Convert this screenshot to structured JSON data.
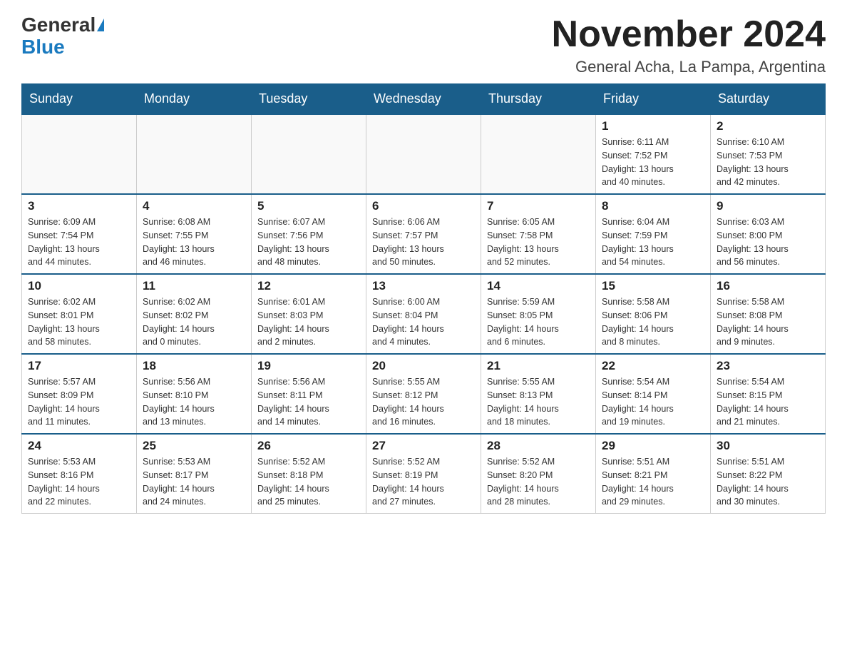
{
  "header": {
    "logo_general": "General",
    "logo_blue": "Blue",
    "month_title": "November 2024",
    "location": "General Acha, La Pampa, Argentina"
  },
  "days_of_week": [
    "Sunday",
    "Monday",
    "Tuesday",
    "Wednesday",
    "Thursday",
    "Friday",
    "Saturday"
  ],
  "weeks": [
    [
      {
        "day": "",
        "info": ""
      },
      {
        "day": "",
        "info": ""
      },
      {
        "day": "",
        "info": ""
      },
      {
        "day": "",
        "info": ""
      },
      {
        "day": "",
        "info": ""
      },
      {
        "day": "1",
        "info": "Sunrise: 6:11 AM\nSunset: 7:52 PM\nDaylight: 13 hours\nand 40 minutes."
      },
      {
        "day": "2",
        "info": "Sunrise: 6:10 AM\nSunset: 7:53 PM\nDaylight: 13 hours\nand 42 minutes."
      }
    ],
    [
      {
        "day": "3",
        "info": "Sunrise: 6:09 AM\nSunset: 7:54 PM\nDaylight: 13 hours\nand 44 minutes."
      },
      {
        "day": "4",
        "info": "Sunrise: 6:08 AM\nSunset: 7:55 PM\nDaylight: 13 hours\nand 46 minutes."
      },
      {
        "day": "5",
        "info": "Sunrise: 6:07 AM\nSunset: 7:56 PM\nDaylight: 13 hours\nand 48 minutes."
      },
      {
        "day": "6",
        "info": "Sunrise: 6:06 AM\nSunset: 7:57 PM\nDaylight: 13 hours\nand 50 minutes."
      },
      {
        "day": "7",
        "info": "Sunrise: 6:05 AM\nSunset: 7:58 PM\nDaylight: 13 hours\nand 52 minutes."
      },
      {
        "day": "8",
        "info": "Sunrise: 6:04 AM\nSunset: 7:59 PM\nDaylight: 13 hours\nand 54 minutes."
      },
      {
        "day": "9",
        "info": "Sunrise: 6:03 AM\nSunset: 8:00 PM\nDaylight: 13 hours\nand 56 minutes."
      }
    ],
    [
      {
        "day": "10",
        "info": "Sunrise: 6:02 AM\nSunset: 8:01 PM\nDaylight: 13 hours\nand 58 minutes."
      },
      {
        "day": "11",
        "info": "Sunrise: 6:02 AM\nSunset: 8:02 PM\nDaylight: 14 hours\nand 0 minutes."
      },
      {
        "day": "12",
        "info": "Sunrise: 6:01 AM\nSunset: 8:03 PM\nDaylight: 14 hours\nand 2 minutes."
      },
      {
        "day": "13",
        "info": "Sunrise: 6:00 AM\nSunset: 8:04 PM\nDaylight: 14 hours\nand 4 minutes."
      },
      {
        "day": "14",
        "info": "Sunrise: 5:59 AM\nSunset: 8:05 PM\nDaylight: 14 hours\nand 6 minutes."
      },
      {
        "day": "15",
        "info": "Sunrise: 5:58 AM\nSunset: 8:06 PM\nDaylight: 14 hours\nand 8 minutes."
      },
      {
        "day": "16",
        "info": "Sunrise: 5:58 AM\nSunset: 8:08 PM\nDaylight: 14 hours\nand 9 minutes."
      }
    ],
    [
      {
        "day": "17",
        "info": "Sunrise: 5:57 AM\nSunset: 8:09 PM\nDaylight: 14 hours\nand 11 minutes."
      },
      {
        "day": "18",
        "info": "Sunrise: 5:56 AM\nSunset: 8:10 PM\nDaylight: 14 hours\nand 13 minutes."
      },
      {
        "day": "19",
        "info": "Sunrise: 5:56 AM\nSunset: 8:11 PM\nDaylight: 14 hours\nand 14 minutes."
      },
      {
        "day": "20",
        "info": "Sunrise: 5:55 AM\nSunset: 8:12 PM\nDaylight: 14 hours\nand 16 minutes."
      },
      {
        "day": "21",
        "info": "Sunrise: 5:55 AM\nSunset: 8:13 PM\nDaylight: 14 hours\nand 18 minutes."
      },
      {
        "day": "22",
        "info": "Sunrise: 5:54 AM\nSunset: 8:14 PM\nDaylight: 14 hours\nand 19 minutes."
      },
      {
        "day": "23",
        "info": "Sunrise: 5:54 AM\nSunset: 8:15 PM\nDaylight: 14 hours\nand 21 minutes."
      }
    ],
    [
      {
        "day": "24",
        "info": "Sunrise: 5:53 AM\nSunset: 8:16 PM\nDaylight: 14 hours\nand 22 minutes."
      },
      {
        "day": "25",
        "info": "Sunrise: 5:53 AM\nSunset: 8:17 PM\nDaylight: 14 hours\nand 24 minutes."
      },
      {
        "day": "26",
        "info": "Sunrise: 5:52 AM\nSunset: 8:18 PM\nDaylight: 14 hours\nand 25 minutes."
      },
      {
        "day": "27",
        "info": "Sunrise: 5:52 AM\nSunset: 8:19 PM\nDaylight: 14 hours\nand 27 minutes."
      },
      {
        "day": "28",
        "info": "Sunrise: 5:52 AM\nSunset: 8:20 PM\nDaylight: 14 hours\nand 28 minutes."
      },
      {
        "day": "29",
        "info": "Sunrise: 5:51 AM\nSunset: 8:21 PM\nDaylight: 14 hours\nand 29 minutes."
      },
      {
        "day": "30",
        "info": "Sunrise: 5:51 AM\nSunset: 8:22 PM\nDaylight: 14 hours\nand 30 minutes."
      }
    ]
  ]
}
